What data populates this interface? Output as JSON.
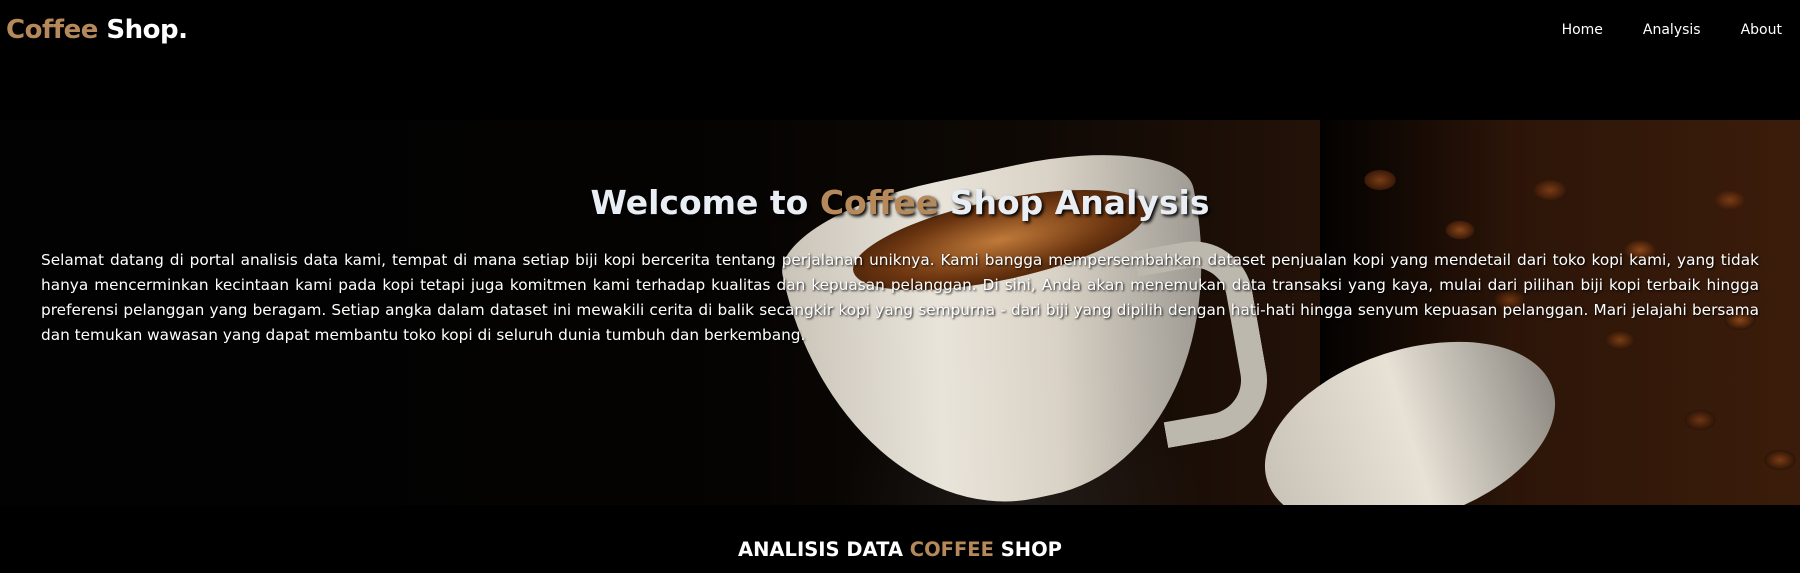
{
  "navbar": {
    "logo_word1": "Coffee",
    "logo_word2": "Shop.",
    "links": [
      "Home",
      "Analysis",
      "About"
    ]
  },
  "hero": {
    "title_pre": "Welcome to ",
    "title_accent": "Coffee",
    "title_post": " Shop Analysis",
    "text": "Selamat datang di portal analisis data kami, tempat di mana setiap biji kopi bercerita tentang perjalanan uniknya. Kami bangga mempersembahkan dataset penjualan kopi yang mendetail dari toko kopi kami, yang tidak hanya mencerminkan kecintaan kami pada kopi tetapi juga komitmen kami terhadap kualitas dan kepuasan pelanggan. Di sini, Anda akan menemukan data transaksi yang kaya, mulai dari pilihan biji kopi terbaik hingga preferensi pelanggan yang beragam. Setiap angka dalam dataset ini mewakili cerita di balik secangkir kopi yang sempurna - dari biji yang dipilih dengan hati-hati hingga senyum kepuasan pelanggan. Mari jelajahi bersama dan temukan wawasan yang dapat membantu toko kopi di seluruh dunia tumbuh dan berkembang."
  },
  "section": {
    "title_pre": "ANALISIS DATA ",
    "title_accent": "COFFEE",
    "title_post": " SHOP"
  },
  "colors": {
    "accent": "#b6895b",
    "background": "#000000",
    "text": "#ffffff"
  }
}
